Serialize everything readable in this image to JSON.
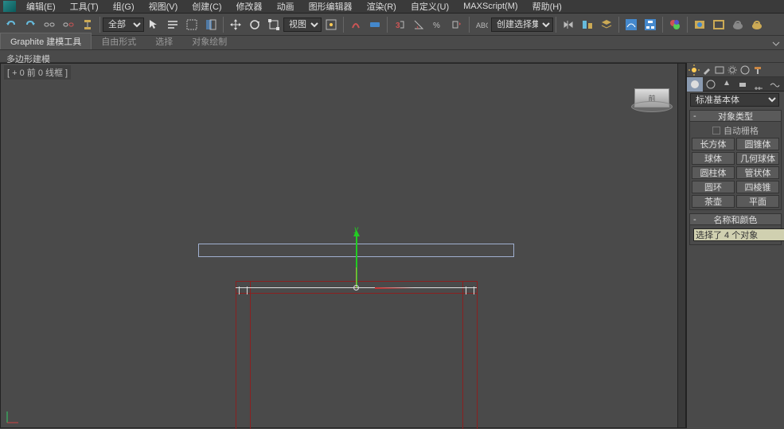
{
  "menu": {
    "items": [
      "编辑(E)",
      "工具(T)",
      "组(G)",
      "视图(V)",
      "创建(C)",
      "修改器",
      "动画",
      "图形编辑器",
      "渲染(R)",
      "自定义(U)",
      "MAXScript(M)",
      "帮助(H)"
    ]
  },
  "toolbar": {
    "sel_all": "全部",
    "viewmode": "视图",
    "sel_set": "创建选择集"
  },
  "ribbon": {
    "tabs": [
      "Graphite 建模工具",
      "自由形式",
      "选择",
      "对象绘制"
    ],
    "sub": "多边形建模"
  },
  "viewport": {
    "label": "[ + 0 前 0 线框 ]",
    "axis_y": "y"
  },
  "panel": {
    "category": "标准基本体",
    "roll_obj": "对象类型",
    "auto": "自动栅格",
    "prims": [
      "长方体",
      "圆锥体",
      "球体",
      "几何球体",
      "圆柱体",
      "管状体",
      "圆环",
      "四棱锥",
      "茶壶",
      "平面"
    ],
    "roll_name": "名称和颜色",
    "sel_text": "选择了 4 个对象"
  }
}
